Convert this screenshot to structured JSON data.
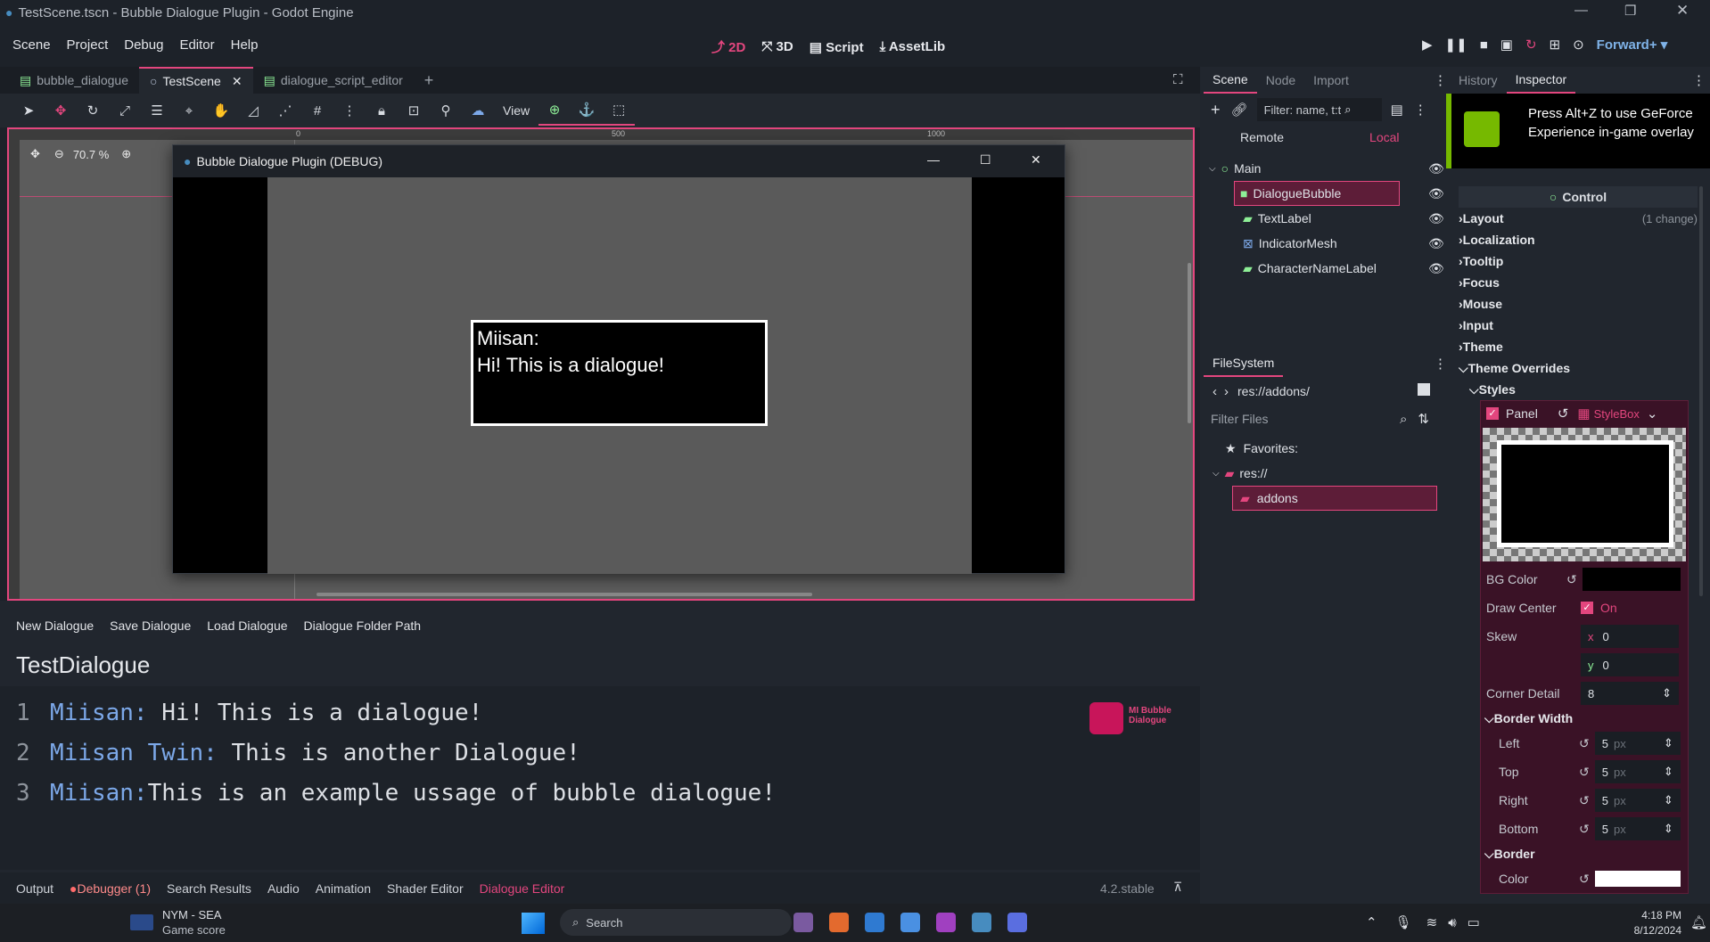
{
  "window_title": "TestScene.tscn - Bubble Dialogue Plugin - Godot Engine",
  "menu": [
    "Scene",
    "Project",
    "Debug",
    "Editor",
    "Help"
  ],
  "workspaces": {
    "w2d": "2D",
    "w3d": "3D",
    "script": "Script",
    "assetlib": "AssetLib"
  },
  "renderer": "Forward+",
  "scene_tabs": [
    "bubble_dialogue",
    "TestScene",
    "dialogue_script_editor"
  ],
  "toolbar": {
    "view": "View"
  },
  "viewport": {
    "zoom": "70.7 %",
    "ruler": [
      "0",
      "500",
      "1000"
    ]
  },
  "debug_window": {
    "title": "Bubble Dialogue Plugin (DEBUG)",
    "speaker": "Miisan:",
    "text": "Hi! This is a dialogue!"
  },
  "dialogue_editor": {
    "buttons": [
      "New Dialogue",
      "Save Dialogue",
      "Load Dialogue",
      "Dialogue Folder Path"
    ],
    "title": "TestDialogue",
    "lines": [
      {
        "num": "1",
        "speaker": "Miisan:",
        "text": " Hi! This is a dialogue!"
      },
      {
        "num": "2",
        "speaker": "Miisan Twin:",
        "text": " This is another Dialogue!"
      },
      {
        "num": "3",
        "speaker": "Miisan:",
        "text": "This is an example ussage of bubble dialogue!"
      }
    ],
    "logo": "MI Bubble Dialogue"
  },
  "bottom_tabs": [
    "Output",
    "Debugger (1)",
    "Search Results",
    "Audio",
    "Animation",
    "Shader Editor",
    "Dialogue Editor"
  ],
  "version": "4.2.stable",
  "scene_dock": {
    "tabs": [
      "Scene",
      "Node",
      "Import"
    ],
    "filter_placeholder": "Filter: name, t:t",
    "remote": "Remote",
    "local": "Local",
    "tree": [
      "Main",
      "DialogueBubble",
      "TextLabel",
      "IndicatorMesh",
      "CharacterNameLabel"
    ]
  },
  "filesystem": {
    "tab": "FileSystem",
    "path": "res://addons/",
    "filter_placeholder": "Filter Files",
    "favorites": "Favorites:",
    "root": "res://",
    "folder": "addons"
  },
  "inspector": {
    "tabs": [
      "History",
      "Inspector"
    ],
    "nvidia": "Press Alt+Z to use GeForce Experience in-game overlay",
    "class": "Control",
    "sections": [
      "Layout",
      "Localization",
      "Tooltip",
      "Focus",
      "Mouse",
      "Input",
      "Theme",
      "Theme Overrides"
    ],
    "layout_change": "(1 change)",
    "styles": "Styles",
    "panel": "Panel",
    "stylebox": "StyleBox",
    "bg_color": "BG Color",
    "draw_center": "Draw Center",
    "draw_center_value": "On",
    "skew": "Skew",
    "skew_x": "0",
    "skew_y": "0",
    "x": "x",
    "y": "y",
    "corner_detail": "Corner Detail",
    "corner_detail_value": "8",
    "border_width": "Border Width",
    "bw": [
      {
        "label": "Left",
        "value": "5"
      },
      {
        "label": "Top",
        "value": "5"
      },
      {
        "label": "Right",
        "value": "5"
      },
      {
        "label": "Bottom",
        "value": "5"
      }
    ],
    "px": "px",
    "border": "Border",
    "color": "Color"
  },
  "taskbar": {
    "news": "NYM - SEA",
    "news_sub": "Game score",
    "search": "Search",
    "time": "4:18 PM",
    "date": "8/12/2024"
  },
  "colors": {
    "accent": "#e3467e",
    "bg": "#1d2229",
    "panel": "#21262e",
    "speaker": "#7ca8e8"
  }
}
